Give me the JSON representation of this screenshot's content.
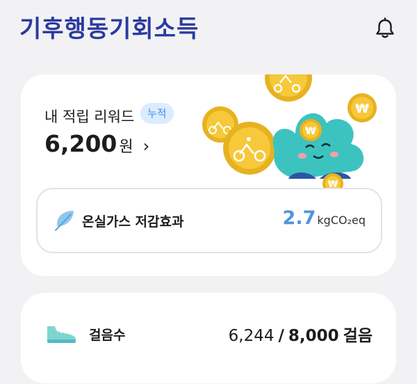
{
  "header": {
    "logo_part1": "기후",
    "logo_part2": "행동기회소득",
    "bell_icon": "bell-icon"
  },
  "reward": {
    "title": "내 적립 리워드",
    "badge": "누적",
    "amount": "6,200",
    "unit": "원",
    "chevron": "›"
  },
  "ghg": {
    "label": "온실가스 저감효과",
    "value": "2.7",
    "unit": "kgCO₂eq",
    "icon": "leaf-icon"
  },
  "steps": {
    "label": "걸음수",
    "current": "6,244",
    "separator": "/",
    "goal": "8,000",
    "unit": "걸음",
    "icon": "shoe-icon"
  },
  "colors": {
    "brand": "#2b3aa0",
    "accent_blue": "#4f95de",
    "badge_bg": "#dcecff",
    "coin": "#f2c12e",
    "mascot": "#3cc3c0"
  }
}
